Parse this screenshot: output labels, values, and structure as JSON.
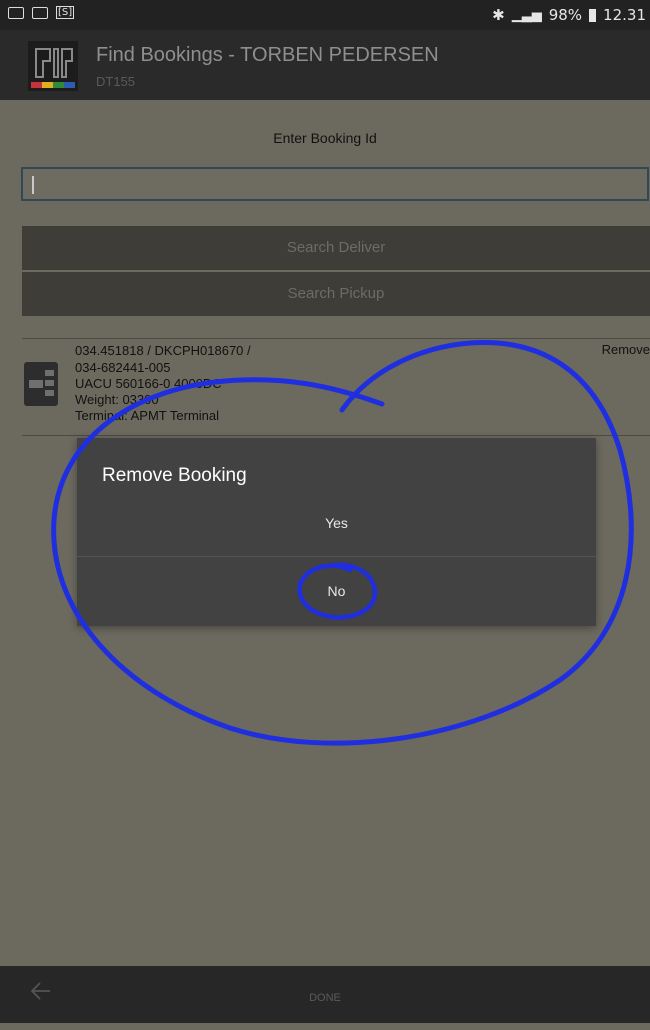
{
  "status": {
    "battery_text": "98%",
    "time": "12.31",
    "s_badge": "[S]"
  },
  "app": {
    "title": "Find Bookings - TORBEN PEDERSEN",
    "subtitle": "DT155",
    "logo_colors": [
      "#c8323a",
      "#e0b020",
      "#2f8a3a",
      "#2d5db0"
    ]
  },
  "form": {
    "label": "Enter Booking Id",
    "input_value": "",
    "search_deliver": "Search Deliver",
    "search_pickup": "Search Pickup"
  },
  "booking": {
    "lines": [
      "034.451818 / DKCPH018670 /",
      "034-682441-005",
      "UACU 560166-0 4000DC",
      "Weight: 03300",
      "Terminal: APMT Terminal"
    ],
    "remove_label": "Remove"
  },
  "dialog": {
    "title": "Remove Booking",
    "yes": "Yes",
    "no": "No"
  },
  "navbar": {
    "done": "DONE"
  },
  "annotation_color": "#1f2fe0"
}
